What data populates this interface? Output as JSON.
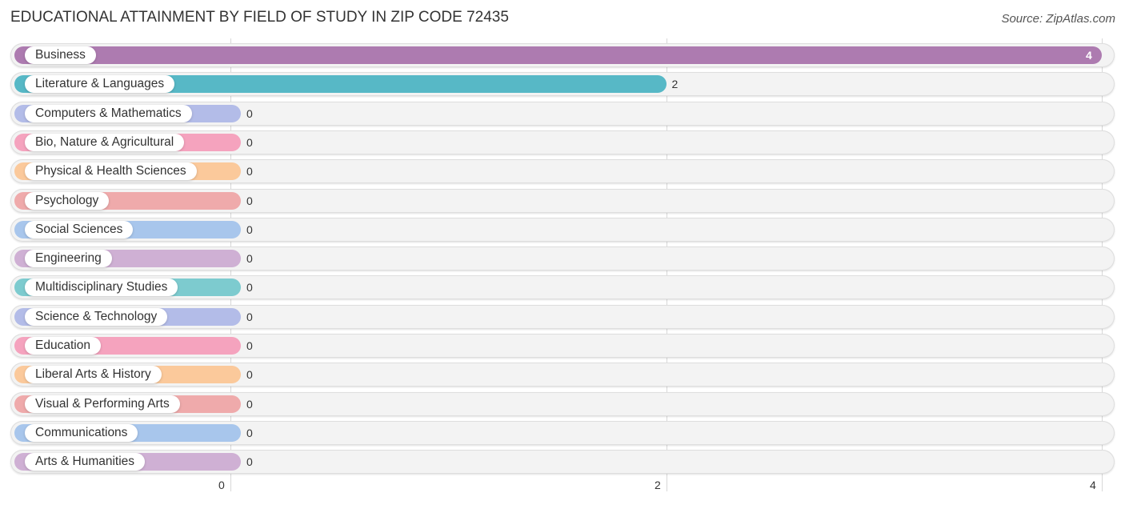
{
  "title": "EDUCATIONAL ATTAINMENT BY FIELD OF STUDY IN ZIP CODE 72435",
  "source": "Source: ZipAtlas.com",
  "chart_data": {
    "type": "bar",
    "orientation": "horizontal",
    "title": "EDUCATIONAL ATTAINMENT BY FIELD OF STUDY IN ZIP CODE 72435",
    "xlabel": "",
    "ylabel": "",
    "xlim": [
      0,
      4
    ],
    "x_ticks": [
      "0",
      "2",
      "4"
    ],
    "grid": true,
    "categories": [
      "Business",
      "Literature & Languages",
      "Computers & Mathematics",
      "Bio, Nature & Agricultural",
      "Physical & Health Sciences",
      "Psychology",
      "Social Sciences",
      "Engineering",
      "Multidisciplinary Studies",
      "Science & Technology",
      "Education",
      "Liberal Arts & History",
      "Visual & Performing Arts",
      "Communications",
      "Arts & Humanities"
    ],
    "values": [
      4,
      2,
      0,
      0,
      0,
      0,
      0,
      0,
      0,
      0,
      0,
      0,
      0,
      0,
      0
    ],
    "colors": [
      "#ad7bb0",
      "#57b8c6",
      "#b3bce8",
      "#f5a3be",
      "#fbc99b",
      "#efaaab",
      "#a8c6ec",
      "#cfb0d4",
      "#7dcbcf",
      "#b3bce8",
      "#f5a3be",
      "#fbc99b",
      "#efaaab",
      "#a8c6ec",
      "#cfb0d4"
    ]
  }
}
